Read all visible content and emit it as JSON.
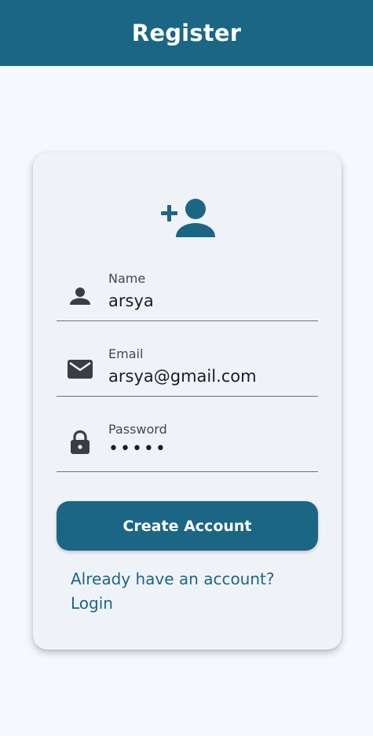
{
  "appbar": {
    "title": "Register"
  },
  "form": {
    "header_icon": "person-add-icon",
    "fields": [
      {
        "label": "Name",
        "value": "arsya",
        "icon": "person-icon"
      },
      {
        "label": "Email",
        "value": "arsya@gmail.com",
        "icon": "mail-icon"
      },
      {
        "label": "Password",
        "value": "•••••",
        "icon": "lock-icon"
      }
    ],
    "submit_label": "Create Account",
    "login_link": "Already have an account? Login"
  },
  "colors": {
    "primary": "#1b6685",
    "background": "#f5f9fd",
    "card": "#eff3f8",
    "icon": "#3a3d42"
  }
}
